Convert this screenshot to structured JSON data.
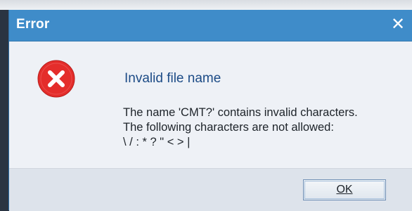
{
  "dialog": {
    "title": "Error",
    "close_glyph": "✕",
    "icon": "error-icon",
    "heading": "Invalid file name",
    "message_lines": [
      "The name 'CMT?' contains invalid characters.",
      "The following characters are not allowed:",
      "\\ / : * ? \" < > |"
    ],
    "ok_label": "OK"
  },
  "colors": {
    "titlebar": "#3f8cc9",
    "heading_text": "#1c4b86",
    "error_red": "#e42d2b"
  }
}
